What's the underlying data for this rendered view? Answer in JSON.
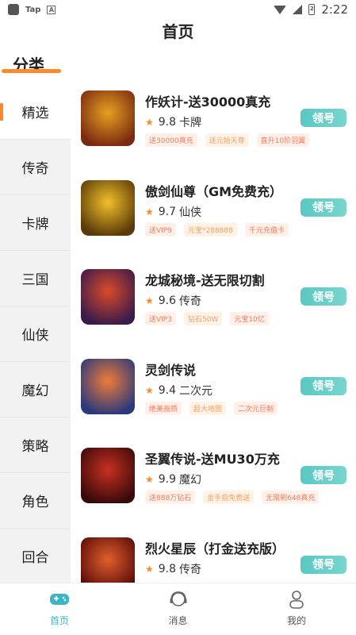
{
  "status": {
    "tap_label": "Tap",
    "a_label": "A",
    "battery_label": "2",
    "time": "2:22"
  },
  "header": {
    "title": "首页"
  },
  "section": {
    "title": "分类"
  },
  "sidebar": {
    "items": [
      {
        "label": "精选",
        "active": true
      },
      {
        "label": "传奇"
      },
      {
        "label": "卡牌"
      },
      {
        "label": "三国"
      },
      {
        "label": "仙侠"
      },
      {
        "label": "魔幻"
      },
      {
        "label": "策略"
      },
      {
        "label": "角色"
      },
      {
        "label": "回合"
      }
    ]
  },
  "games": [
    {
      "name": "作妖计-送30000真充",
      "score": "9.8",
      "genre": "卡牌",
      "tags": [
        "送30000真充",
        "送元始天尊",
        "直升10阶羽翼"
      ],
      "button": "领号",
      "colors": [
        "#7a2a10",
        "#e8a020"
      ]
    },
    {
      "name": "傲剑仙尊（GM免费充）",
      "score": "9.7",
      "genre": "仙侠",
      "tags": [
        "送VIP9",
        "元宝*288888",
        "千元充值卡"
      ],
      "button": "领号",
      "colors": [
        "#5a3a08",
        "#f2c02a"
      ]
    },
    {
      "name": "龙城秘境-送无限切割",
      "score": "9.6",
      "genre": "传奇",
      "tags": [
        "送VIP3",
        "钻石50W",
        "元宝10亿"
      ],
      "button": "领号",
      "colors": [
        "#3a1a4a",
        "#d94a2a"
      ]
    },
    {
      "name": "灵剑传说",
      "score": "9.4",
      "genre": "二次元",
      "tags": [
        "绝美画质",
        "超大地图",
        "二次元巨制"
      ],
      "button": "领号",
      "colors": [
        "#2a3a7a",
        "#f07a3a"
      ]
    },
    {
      "name": "圣翼传说-送MU30万充",
      "score": "9.9",
      "genre": "魔幻",
      "tags": [
        "送888万钻石",
        "金手指免费送",
        "无限刷648真充"
      ],
      "button": "领号",
      "colors": [
        "#3a0a0a",
        "#c83020"
      ]
    },
    {
      "name": "烈火星辰（打金送充版）",
      "score": "9.8",
      "genre": "传奇",
      "tags": [],
      "button": "领号",
      "colors": [
        "#5a0a0a",
        "#e0602a"
      ]
    }
  ],
  "bottom_nav": [
    {
      "label": "首页",
      "icon": "gamepad-icon",
      "active": true
    },
    {
      "label": "消息",
      "icon": "headset-icon"
    },
    {
      "label": "我的",
      "icon": "user-icon"
    }
  ],
  "accent_color": "#ff8a2c",
  "button_color": "#5ec9c3",
  "nav_active_color": "#3bb6c9"
}
